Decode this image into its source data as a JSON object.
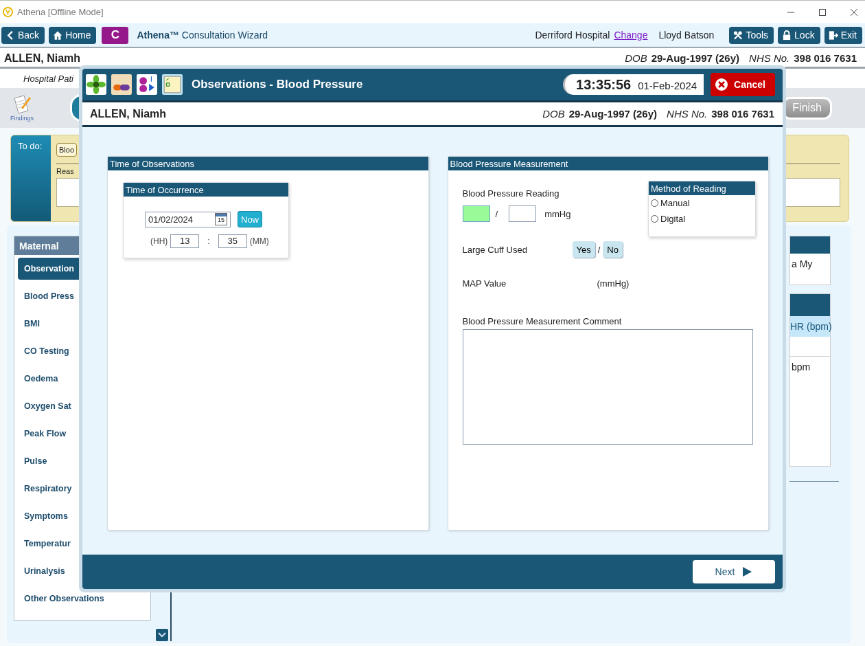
{
  "window": {
    "title": "Athena [Offline Mode]"
  },
  "toolbar": {
    "nav_buttons": [
      {
        "label": "Back",
        "kind": "back"
      },
      {
        "label": "Home",
        "kind": "home"
      }
    ],
    "app_badge": "C",
    "app_title": "**Athena™** Consultation Wizard",
    "hospital": "Derriford Hospital",
    "change_link": "Change",
    "user": "Lloyd Batson",
    "actions": [
      {
        "label": "Tools",
        "kind": "tools"
      },
      {
        "label": "Lock",
        "kind": "lock"
      },
      {
        "label": "Exit",
        "kind": "exit"
      }
    ]
  },
  "patient": {
    "name": "ALLEN, Niamh",
    "dob_label": "DOB",
    "dob": "29-Aug-1997 (26y)",
    "nhs_label": "NHS No.",
    "nhs": "398 016 7631"
  },
  "subheader": "Hospital Pati",
  "steps": {
    "findings_label": "Findings",
    "finish": {
      "label": "Finish",
      "disabled": true
    }
  },
  "todo": {
    "label": "To do:",
    "tag": "Bloo",
    "reason_label": "Reas"
  },
  "sidebar": {
    "title": "Maternal",
    "items": [
      {
        "label": "Observation",
        "selected": true
      },
      {
        "label": "Blood Press",
        "selected": false
      },
      {
        "label": "BMI",
        "selected": false
      },
      {
        "label": "CO Testing",
        "selected": false
      },
      {
        "label": "Oedema",
        "selected": false
      },
      {
        "label": "Oxygen Sat",
        "selected": false
      },
      {
        "label": "Peak Flow",
        "selected": false
      },
      {
        "label": "Pulse",
        "selected": false
      },
      {
        "label": "Respiratory",
        "selected": false
      },
      {
        "label": "Symptoms",
        "selected": false
      },
      {
        "label": "Temperatur",
        "selected": false
      },
      {
        "label": "Urinalysis",
        "selected": false
      },
      {
        "label": "Other Observations",
        "selected": false
      }
    ]
  },
  "background_fragments": {
    "panel_text": "a My",
    "column_header": "HR (bpm)",
    "cell": "bpm"
  },
  "modal": {
    "title": "Observations - Blood Pressure",
    "time": "13:35:56",
    "date": "01-Feb-2024",
    "cancel": "Cancel",
    "patient": {
      "name": "ALLEN, Niamh",
      "dob_label": "DOB",
      "dob": "29-Aug-1997 (26y)",
      "nhs_label": "NHS No.",
      "nhs": "398 016 7631"
    },
    "time_panel": {
      "title": "Time of Observations",
      "sub_title": "Time of Occurrence",
      "date_value": "01/02/2024",
      "calendar_day": "15",
      "now": "Now",
      "hh_label": "(HH)",
      "hour": "13",
      "colon": ":",
      "minute": "35",
      "mm_label": "(MM)"
    },
    "bp_panel": {
      "title": "Blood Pressure Measurement",
      "reading_label": "Blood Pressure Reading",
      "readings": [
        {
          "focused": true
        },
        {
          "focused": false
        }
      ],
      "separator": "/",
      "unit": "mmHg",
      "method": {
        "title": "Method of Reading",
        "options": [
          {
            "label": "Manual",
            "selected": false
          },
          {
            "label": "Digital",
            "selected": false
          }
        ]
      },
      "cuff_label": "Large Cuff Used",
      "cuff_options": [
        {
          "label": "Yes",
          "selected": false
        },
        {
          "label": "No",
          "selected": false
        }
      ],
      "cuff_separator": "/",
      "map_label": "MAP Value",
      "map_unit": "(mmHg)",
      "comment_label": "Blood Pressure Measurement Comment"
    },
    "next": "Next"
  }
}
